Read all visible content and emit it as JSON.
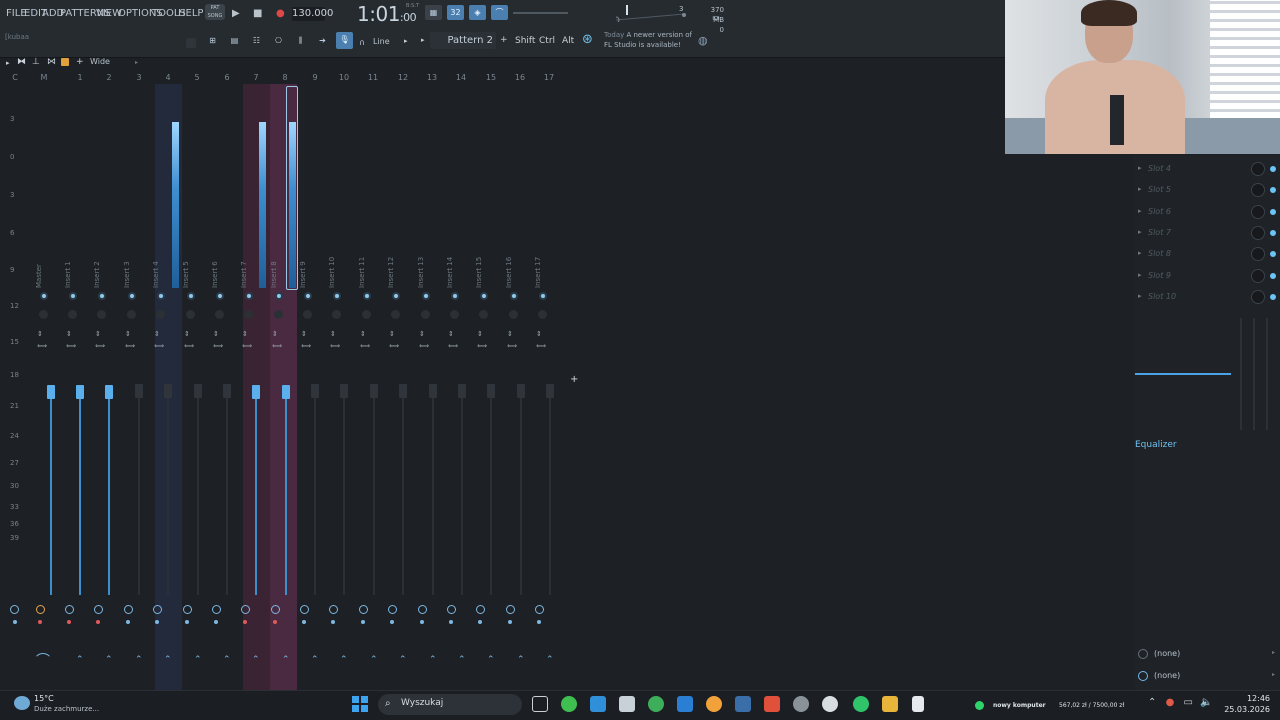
{
  "menu": {
    "items": [
      "FILE",
      "EDIT",
      "ADD",
      "PATTERNS",
      "VIEW",
      "OPTIONS",
      "TOOLS",
      "HELP"
    ],
    "pat_song": [
      "PAT",
      "SONG"
    ]
  },
  "transport": {
    "tempo": "130.000",
    "time": "1:01",
    "time_ms": ":00",
    "time_sub": "B:S:T",
    "poly": "3",
    "memory": "370 MB",
    "memory_sub": "0",
    "user": "[kubaa"
  },
  "toolbar2": {
    "line_mode": "Line",
    "pattern": "Pattern 2",
    "shift": "Shift",
    "ctrl": "Ctrl",
    "alt": "Alt",
    "news_today": "Today",
    "news_line1": "A newer version of",
    "news_line2": "FL Studio is available!"
  },
  "mixer": {
    "view": "Wide",
    "track_numbers": [
      "C",
      "M",
      "1",
      "2",
      "3",
      "4",
      "5",
      "6",
      "7",
      "8",
      "9",
      "10",
      "11",
      "12",
      "13",
      "14",
      "15",
      "16",
      "17"
    ],
    "insert_names": [
      "Master",
      "Insert 1",
      "Insert 2",
      "Insert 3",
      "Insert 4",
      "Insert 5",
      "Insert 6",
      "Insert 7",
      "Insert 8",
      "Insert 9",
      "Insert 10",
      "Insert 11",
      "Insert 12",
      "Insert 13",
      "Insert 14",
      "Insert 15",
      "Insert 16",
      "Insert 17"
    ],
    "db_scale": [
      "3",
      "0",
      "3",
      "6",
      "9",
      "12",
      "15",
      "18",
      "21",
      "24",
      "27",
      "30",
      "33",
      "36",
      "39"
    ]
  },
  "fx_panel": {
    "slots": [
      "Slot 4",
      "Slot 5",
      "Slot 6",
      "Slot 7",
      "Slot 8",
      "Slot 9",
      "Slot 10"
    ],
    "equalizer": "Equalizer",
    "input": "(none)",
    "output": "(none)"
  },
  "taskbar": {
    "weather_temp": "15°C",
    "weather_desc": "Duże zachmurze...",
    "search_placeholder": "Wyszukaj",
    "wallet_name": "nowy komputer",
    "wallet_value": "567,02 zł / 7500,00 zł",
    "time": "12:46",
    "date": "25.03.2026"
  },
  "colors": {
    "accent": "#4aa4e6",
    "insert4_bg": "#232a3b",
    "insert7_bg": "#3a2333",
    "meter": "#5ab0ec"
  }
}
